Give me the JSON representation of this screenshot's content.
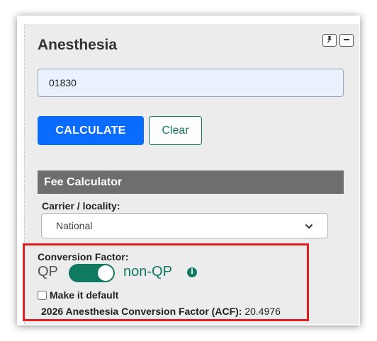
{
  "panel": {
    "title": "Anesthesia",
    "pin_icon": "pin-icon",
    "minimize_icon": "minimize-icon"
  },
  "search": {
    "value": "01830"
  },
  "actions": {
    "calculate_label": "CALCULATE",
    "clear_label": "Clear"
  },
  "fee_calculator": {
    "header": "Fee Calculator",
    "carrier_label": "Carrier / locality:",
    "carrier_selected": "National",
    "conversion_factor_label": "Conversion Factor:",
    "toggle_left_label": "QP",
    "toggle_right_label": "non-QP",
    "toggle_on": true,
    "info_icon": "info-icon",
    "make_default_label": "Make it default",
    "make_default_checked": false,
    "acf_label": "2026 Anesthesia Conversion Factor (ACF):",
    "acf_value": "20.4976"
  },
  "colors": {
    "primary_blue": "#0a6cff",
    "accent_green": "#0f7a5f",
    "header_gray": "#6e6e6e",
    "highlight_red": "#e02020",
    "panel_bg": "#ececec",
    "input_bg": "#e9f0fe"
  }
}
